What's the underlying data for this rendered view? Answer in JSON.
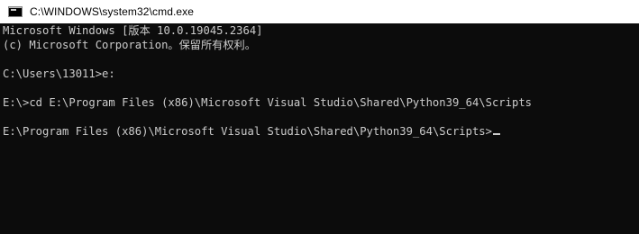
{
  "window": {
    "title": "C:\\WINDOWS\\system32\\cmd.exe",
    "icon": "cmd-console-icon"
  },
  "console": {
    "lines": [
      "Microsoft Windows [版本 10.0.19045.2364]",
      "(c) Microsoft Corporation。保留所有权利。",
      "",
      "C:\\Users\\13011>e:",
      "",
      "E:\\>cd E:\\Program Files (x86)\\Microsoft Visual Studio\\Shared\\Python39_64\\Scripts",
      "",
      "E:\\Program Files (x86)\\Microsoft Visual Studio\\Shared\\Python39_64\\Scripts>"
    ]
  },
  "colors": {
    "console_bg": "#0c0c0c",
    "console_fg": "#cccccc",
    "titlebar_bg": "#ffffff"
  }
}
